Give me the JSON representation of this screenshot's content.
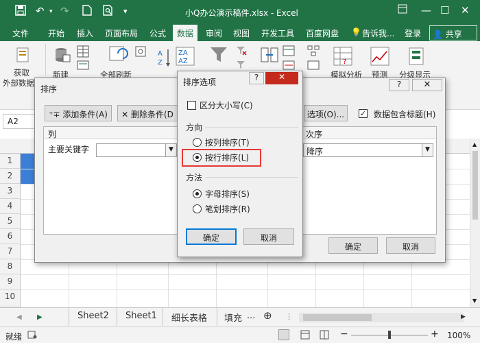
{
  "titlebar": {
    "title": "小Q办公演示稿件.xlsx - Excel",
    "save_icon": "save-icon",
    "undo_icon": "undo-icon",
    "redo_icon": "redo-icon"
  },
  "tabs": [
    "文件",
    "开始",
    "插入",
    "页面布局",
    "公式",
    "数据",
    "审阅",
    "视图",
    "开发工具",
    "百度网盘",
    "告诉我...",
    "登录"
  ],
  "share_label": "共享",
  "ribbon": {
    "get_external": "获取",
    "get_external_2": "外部数据",
    "new_query": "新建",
    "refresh_all": "全部刷新",
    "what_if": "模拟分析",
    "forecast": "预测",
    "outline": "分级显示"
  },
  "namebox": "A2",
  "rows": [
    "1",
    "2",
    "3",
    "4",
    "5",
    "6",
    "7",
    "8",
    "9",
    "10"
  ],
  "sheets": [
    "Sheet2",
    "Sheet1",
    "细长表格",
    "填充"
  ],
  "status": {
    "ready": "就绪",
    "zoom": "100%"
  },
  "sort_dialog": {
    "title": "排序",
    "add_condition": "添加条件(A)",
    "delete_condition": "删除条件(D",
    "options": "选项(O)...",
    "has_headers": "数据包含标题(H)",
    "col_header": "列",
    "order_header": "次序",
    "primary_key": "主要关键字",
    "order_value": "降序",
    "ok": "确定",
    "cancel": "取消"
  },
  "options_dialog": {
    "title": "排序选项",
    "help": "?",
    "case_sensitive": "区分大小写(C)",
    "direction_label": "方向",
    "by_column": "按列排序(T)",
    "by_row": "按行排序(L)",
    "method_label": "方法",
    "alphabetic": "字母排序(S)",
    "stroke": "笔划排序(R)",
    "ok": "确定",
    "cancel": "取消"
  },
  "colors": {
    "excel_green": "#217346",
    "highlight_red": "#e53935",
    "selection_blue": "#3c7fd6"
  }
}
